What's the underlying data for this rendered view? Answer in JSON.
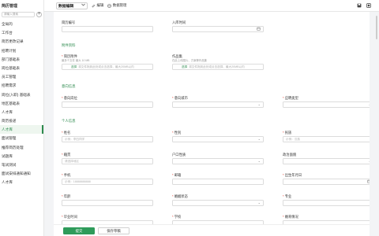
{
  "sidebar": {
    "title": "简历管理",
    "search_placeholder": "请输入搜索",
    "add_label": "+",
    "items": [
      {
        "label": "全局的"
      },
      {
        "label": "工作台"
      },
      {
        "label": "简历更改记录"
      },
      {
        "label": "招聘计划"
      },
      {
        "label": "部门基础表"
      },
      {
        "label": "岗位基础表"
      },
      {
        "label": "员工管理"
      },
      {
        "label": "招聘需求"
      },
      {
        "label": "岗位(入职) 基础表"
      },
      {
        "label": "地区基础表"
      },
      {
        "label": "人才库"
      },
      {
        "label": "简历投递"
      },
      {
        "label": "人才库",
        "active": true
      },
      {
        "label": "面试管理"
      },
      {
        "label": "推荐简历处理"
      },
      {
        "label": "试题库"
      },
      {
        "label": "笔试测试"
      },
      {
        "label": "面试安排通知通知"
      },
      {
        "label": "人才库"
      }
    ]
  },
  "topbar": {
    "selected_view": "数据编辑",
    "edit_label": "编辑",
    "data_manage_label": "数据管理"
  },
  "form": {
    "resume_no": {
      "label": "简历编号",
      "value": ""
    },
    "entry_time": {
      "label": "入库时间",
      "value": ""
    },
    "section_attachments": "附件资料",
    "resume_attach": {
      "label": "简历附件",
      "hint": "最多个文件 最大 10 MB",
      "button": "选择",
      "placeholder": "将文件拖到此处或点击选择，最大20MB以内"
    },
    "portfolio": {
      "label": "作品集",
      "hint": "在此上传图片、方案等作品集",
      "button": "选择",
      "placeholder": "将文件拖到此处或点击选择，最大20MB以内"
    },
    "section_intent": "意向信息",
    "intent_post": {
      "label": "意向岗位",
      "value": ""
    },
    "intent_city": {
      "label": "意向城市",
      "value": ""
    },
    "job_type": {
      "label": "应聘类型",
      "value": ""
    },
    "section_personal": "个人信息",
    "name": {
      "label": "姓名",
      "placeholder": "示例：李四同学"
    },
    "gender": {
      "label": "性别",
      "value": ""
    },
    "ethnicity": {
      "label": "民族",
      "placeholder": "示例：汉族"
    },
    "native_place": {
      "label": "籍贯",
      "placeholder": "请选择地区"
    },
    "household": {
      "label": "户口性质",
      "value": ""
    },
    "political": {
      "label": "政治面貌",
      "value": ""
    },
    "phone": {
      "label": "手机",
      "placeholder": "示例：18888888888"
    },
    "email": {
      "label": "邮箱",
      "value": ""
    },
    "birth_date": {
      "label": "出生年月日",
      "value": ""
    },
    "age": {
      "label": "年龄",
      "value": ""
    },
    "marital": {
      "label": "婚姻状态",
      "value": ""
    },
    "major": {
      "label": "专业",
      "value": ""
    },
    "graduation": {
      "label": "毕业时间"
    },
    "school": {
      "label": "学校"
    },
    "marriage_status": {
      "label": "婚育情况"
    }
  },
  "footer": {
    "submit_label": "提交",
    "draft_label": "保存草稿"
  },
  "colors": {
    "accent": "#2e9b5a",
    "section": "#2d8a4e",
    "required": "#e74c3c"
  }
}
